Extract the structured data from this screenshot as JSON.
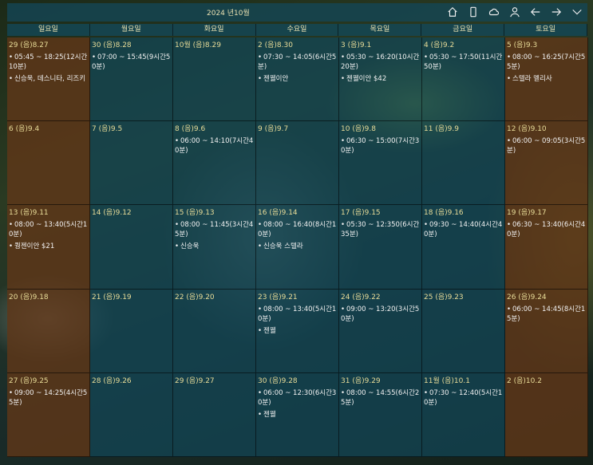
{
  "header": {
    "title": "2024 년10월"
  },
  "toolbar": [
    {
      "name": "home-icon"
    },
    {
      "name": "phone-icon"
    },
    {
      "name": "cloud-icon"
    },
    {
      "name": "user-icon"
    },
    {
      "name": "back-arrow-icon"
    },
    {
      "name": "forward-arrow-icon"
    },
    {
      "name": "chevron-down-icon"
    }
  ],
  "weekdays": [
    "일요일",
    "월요일",
    "화요일",
    "수요일",
    "목요일",
    "금요일",
    "토요일"
  ],
  "colors": {
    "weekday_cell": "#124658",
    "weekend_cell": "#5f3719",
    "date_text": "#e8dc98"
  },
  "days": [
    {
      "date": "29 (음)8.27",
      "events": [
        "05:45 ~ 18:25(12시간10분)",
        "신승욱, 데스니타, 리즈키"
      ]
    },
    {
      "date": "30 (음)8.28",
      "events": [
        "07:00 ~ 15:45(9시간50분)"
      ]
    },
    {
      "date": "10월 (음)8.29",
      "events": []
    },
    {
      "date": "2 (음)8.30",
      "events": [
        "07:30 ~ 14:05(6시간5분)",
        "젠웰이안"
      ]
    },
    {
      "date": "3 (음)9.1",
      "events": [
        "05:30 ~ 16:20(10시간20분)",
        "젠웰이안 $42"
      ]
    },
    {
      "date": "4 (음)9.2",
      "events": [
        "05:30 ~ 17:50(11시간50분)"
      ]
    },
    {
      "date": "5 (음)9.3",
      "events": [
        "08:00 ~ 16:25(7시간55분)",
        "스텔라 멜리사"
      ]
    },
    {
      "date": "6 (음)9.4",
      "events": []
    },
    {
      "date": "7 (음)9.5",
      "events": []
    },
    {
      "date": "8 (음)9.6",
      "events": [
        "06:00 ~ 14:10(7시간40분)"
      ]
    },
    {
      "date": "9 (음)9.7",
      "events": []
    },
    {
      "date": "10 (음)9.8",
      "events": [
        "06:30 ~ 15:00(7시간30분)"
      ]
    },
    {
      "date": "11 (음)9.9",
      "events": []
    },
    {
      "date": "12 (음)9.10",
      "events": [
        "06:00 ~ 09:05(3시간5분)"
      ]
    },
    {
      "date": "13 (음)9.11",
      "events": [
        "08:00 ~ 13:40(5시간10분)",
        "퀑젠이안 $21"
      ]
    },
    {
      "date": "14 (음)9.12",
      "events": []
    },
    {
      "date": "15 (음)9.13",
      "events": [
        "08:00 ~ 11:45(3시간45분)",
        "신승욱"
      ]
    },
    {
      "date": "16 (음)9.14",
      "events": [
        "08:00 ~ 16:40(8시간10분)",
        "신승욱 스텔라"
      ]
    },
    {
      "date": "17 (음)9.15",
      "events": [
        "05:30 ~ 12:350(6시간35분)"
      ]
    },
    {
      "date": "18 (음)9.16",
      "events": [
        "09:30 ~ 14:40(4시간40분)"
      ]
    },
    {
      "date": "19 (음)9.17",
      "events": [
        "06:30 ~ 13:40(6시간40분)"
      ]
    },
    {
      "date": "20 (음)9.18",
      "events": []
    },
    {
      "date": "21 (음)9.19",
      "events": []
    },
    {
      "date": "22 (음)9.20",
      "events": []
    },
    {
      "date": "23 (음)9.21",
      "events": [
        "08:00 ~ 13:40(5시간10분)",
        "젠웰"
      ]
    },
    {
      "date": "24 (음)9.22",
      "events": [
        "09:00 ~ 13:20(3시간50분)"
      ]
    },
    {
      "date": "25 (음)9.23",
      "events": []
    },
    {
      "date": "26 (음)9.24",
      "events": [
        "06:00 ~ 14:45(8시간15분)"
      ]
    },
    {
      "date": "27 (음)9.25",
      "events": [
        "09:00 ~ 14:25(4시간55분)"
      ]
    },
    {
      "date": "28 (음)9.26",
      "events": []
    },
    {
      "date": "29 (음)9.27",
      "events": []
    },
    {
      "date": "30 (음)9.28",
      "events": [
        "06:00 ~ 12:30(6시간30분)",
        "젠웰"
      ]
    },
    {
      "date": "31 (음)9.29",
      "events": [
        "08:00 ~ 14:55(6시간25분)"
      ]
    },
    {
      "date": "11월 (음)10.1",
      "events": [
        "07:30 ~ 12:40(5시간10분)"
      ]
    },
    {
      "date": "2 (음)10.2",
      "events": []
    }
  ]
}
